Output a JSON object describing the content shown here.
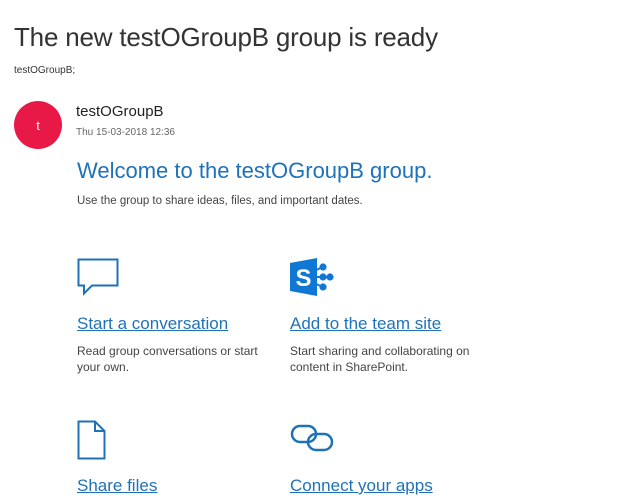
{
  "email": {
    "subject": "The new testOGroupB group is ready",
    "to": "testOGroupB;",
    "sender": {
      "initial": "t",
      "name": "testOGroupB",
      "date": "Thu 15-03-2018 12:36",
      "avatar_color": "#e81947"
    }
  },
  "welcome": {
    "title": "Welcome to the testOGroupB group.",
    "description": "Use the group to share ideas, files, and important dates."
  },
  "cards": [
    {
      "icon": "chat-bubble-icon",
      "link": "Start a conversation",
      "description": "Read group conversations or start your own."
    },
    {
      "icon": "sharepoint-icon",
      "link": "Add to the team site",
      "description": "Start sharing and collaborating on content in SharePoint."
    },
    {
      "icon": "document-icon",
      "link": "Share files",
      "description": ""
    },
    {
      "icon": "link-icon",
      "link": "Connect your apps",
      "description": ""
    }
  ],
  "colors": {
    "accent": "#1f72b8",
    "sharepoint": "#0f78d4"
  }
}
